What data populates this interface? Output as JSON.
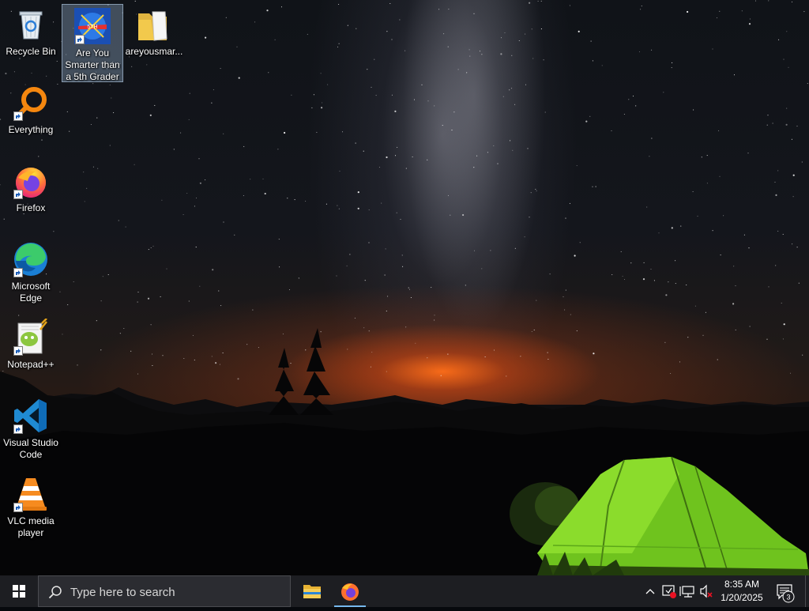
{
  "desktop": {
    "icons": [
      {
        "label": "Recycle Bin",
        "icon": "recycle-bin-icon"
      },
      {
        "label": "Are You Smarter than a 5th Grader",
        "icon": "game-icon",
        "selected": true
      },
      {
        "label": "areyousmar...",
        "icon": "folder-icon"
      },
      {
        "label": "Everything",
        "icon": "everything-search-icon"
      },
      {
        "label": "Firefox",
        "icon": "firefox-icon"
      },
      {
        "label": "Microsoft Edge",
        "icon": "edge-icon"
      },
      {
        "label": "Notepad++",
        "icon": "notepadpp-icon"
      },
      {
        "label": "Visual Studio Code",
        "icon": "vscode-icon"
      },
      {
        "label": "VLC media player",
        "icon": "vlc-icon"
      }
    ]
  },
  "taskbar": {
    "search_placeholder": "Type here to search",
    "pinned": [
      {
        "name": "File Explorer",
        "icon": "file-explorer-icon"
      },
      {
        "name": "Firefox",
        "icon": "firefox-icon",
        "active": true
      }
    ],
    "tray": {
      "time": "8:35 AM",
      "date": "1/20/2025",
      "notification_count": "3"
    }
  },
  "colors": {
    "taskbar_bg": "#1d1e22",
    "search_bg": "#2b2c31",
    "selection_bg": "#a0bedc",
    "tent_green": "#7fd323"
  }
}
